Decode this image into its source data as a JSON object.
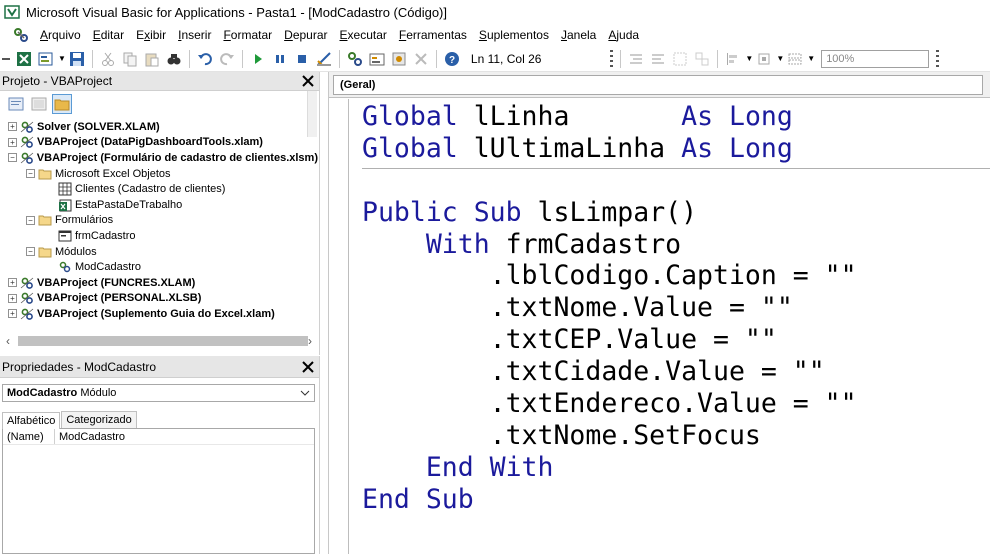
{
  "window": {
    "title": "Microsoft Visual Basic for Applications - Pasta1 - [ModCadastro (Código)]"
  },
  "menu": [
    {
      "label": "Arquivo",
      "underline": "A",
      "rest": "rquivo"
    },
    {
      "label": "Editar",
      "underline": "E",
      "rest": "ditar"
    },
    {
      "label": "Exibir",
      "underline": "E",
      "rest": "xibir",
      "pre": "E",
      "mid": "x",
      "post": "ibir"
    },
    {
      "label": "Inserir",
      "underline": "I",
      "rest": "nserir"
    },
    {
      "label": "Formatar",
      "underline": "F",
      "rest": "ormatar"
    },
    {
      "label": "Depurar",
      "underline": "D",
      "rest": "epurar"
    },
    {
      "label": "Executar",
      "underline": "E",
      "rest": "xecutar"
    },
    {
      "label": "Ferramentas",
      "underline": "F",
      "rest": "erramentas"
    },
    {
      "label": "Suplementos",
      "underline": "S",
      "rest": "uplementos"
    },
    {
      "label": "Janela",
      "underline": "J",
      "rest": "anela"
    },
    {
      "label": "Ajuda",
      "underline": "A",
      "rest": "juda"
    }
  ],
  "toolbar": {
    "position": "Ln 11, Col 26",
    "zoom": "100%"
  },
  "project": {
    "title": "Projeto - VBAProject",
    "tree": [
      {
        "label": "Solver (SOLVER.XLAM)",
        "level": 0,
        "bold": true,
        "expander": "+",
        "icon": "vba-project-icon"
      },
      {
        "label": "VBAProject (DataPigDashboardTools.xlam)",
        "level": 0,
        "bold": true,
        "expander": "+",
        "icon": "vba-project-icon"
      },
      {
        "label": "VBAProject (Formulário de cadastro de clientes.xlsm)",
        "level": 0,
        "bold": true,
        "expander": "−",
        "icon": "vba-project-icon"
      },
      {
        "label": "Microsoft Excel Objetos",
        "level": 1,
        "bold": false,
        "expander": "−",
        "icon": "folder-icon"
      },
      {
        "label": "Clientes (Cadastro de clientes)",
        "level": 2,
        "bold": false,
        "expander": "",
        "icon": "sheet-icon"
      },
      {
        "label": "EstaPastaDeTrabalho",
        "level": 2,
        "bold": false,
        "expander": "",
        "icon": "workbook-icon"
      },
      {
        "label": "Formulários",
        "level": 1,
        "bold": false,
        "expander": "−",
        "icon": "folder-icon"
      },
      {
        "label": "frmCadastro",
        "level": 2,
        "bold": false,
        "expander": "",
        "icon": "form-icon"
      },
      {
        "label": "Módulos",
        "level": 1,
        "bold": false,
        "expander": "−",
        "icon": "folder-icon"
      },
      {
        "label": "ModCadastro",
        "level": 2,
        "bold": false,
        "expander": "",
        "icon": "module-icon"
      },
      {
        "label": "VBAProject (FUNCRES.XLAM)",
        "level": 0,
        "bold": true,
        "expander": "+",
        "icon": "vba-project-icon"
      },
      {
        "label": "VBAProject (PERSONAL.XLSB)",
        "level": 0,
        "bold": true,
        "expander": "+",
        "icon": "vba-project-icon"
      },
      {
        "label": "VBAProject (Suplemento Guia do Excel.xlam)",
        "level": 0,
        "bold": true,
        "expander": "+",
        "icon": "vba-project-icon"
      }
    ]
  },
  "properties": {
    "title": "Propriedades - ModCadastro",
    "object_name": "ModCadastro",
    "object_type": "Módulo",
    "tabs": [
      "Alfabético",
      "Categorizado"
    ],
    "rows": [
      {
        "name": "(Name)",
        "value": "ModCadastro"
      }
    ]
  },
  "code": {
    "object_combo": "(Geral)",
    "lines": [
      [
        {
          "t": "Global",
          "k": true
        },
        {
          "t": " lLinha       "
        },
        {
          "t": "As",
          "k": true
        },
        {
          "t": " "
        },
        {
          "t": "Long",
          "k": true
        }
      ],
      [
        {
          "t": "Global",
          "k": true
        },
        {
          "t": " lUltimaLinha "
        },
        {
          "t": "As",
          "k": true
        },
        {
          "t": " "
        },
        {
          "t": "Long",
          "k": true
        }
      ],
      "SEP",
      [
        {
          "t": "Public",
          "k": true
        },
        {
          "t": " "
        },
        {
          "t": "Sub",
          "k": true
        },
        {
          "t": " lsLimpar()"
        }
      ],
      [
        {
          "t": "    "
        },
        {
          "t": "With",
          "k": true
        },
        {
          "t": " frmCadastro"
        }
      ],
      [
        {
          "t": "        .lblCodigo.Caption = \"\""
        }
      ],
      [
        {
          "t": "        .txtNome.Value = \"\""
        }
      ],
      [
        {
          "t": "        .txtCEP.Value = \"\""
        }
      ],
      [
        {
          "t": "        .txtCidade.Value = \"\""
        }
      ],
      [
        {
          "t": "        .txtEndereco.Value = \"\""
        }
      ],
      [
        {
          "t": "        .txtNome.SetFocus"
        }
      ],
      [
        {
          "t": "    "
        },
        {
          "t": "End With",
          "k": true
        }
      ],
      [
        {
          "t": "End Sub",
          "k": true
        }
      ]
    ]
  }
}
